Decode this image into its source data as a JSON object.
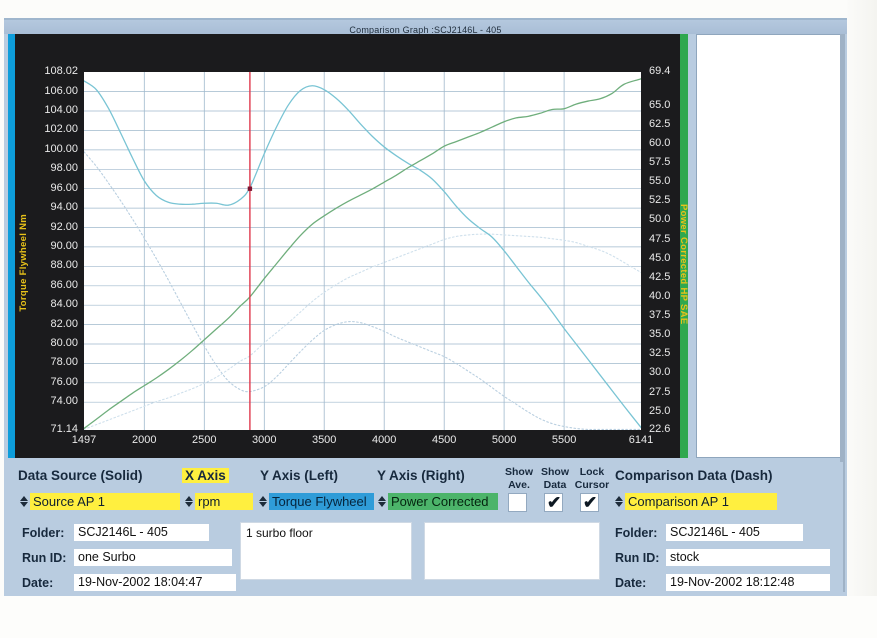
{
  "window": {
    "title": "Comparison Graph :SCJ2146L - 405"
  },
  "chart_data": {
    "type": "line",
    "title": "Comparison Graph :SCJ2146L - 405",
    "xlabel": "rpm",
    "ylabel_left": "Torque Flywheel Nm",
    "ylabel_right": "Power Corrected HP SAE",
    "xlim": [
      1497,
      6141
    ],
    "ylim_left": [
      71.14,
      108.02
    ],
    "ylim_right": [
      22.6,
      69.4
    ],
    "grid": true,
    "legend_position": "none",
    "x_ticks": [
      "1497",
      "2000",
      "2500",
      "3000",
      "3500",
      "4000",
      "4500",
      "5000",
      "5500",
      "6141"
    ],
    "y_ticks_left": [
      "108.02",
      "106.00",
      "104.00",
      "102.00",
      "100.00",
      "98.00",
      "96.00",
      "94.00",
      "92.00",
      "90.00",
      "88.00",
      "86.00",
      "84.00",
      "82.00",
      "80.00",
      "78.00",
      "76.00",
      "74.00",
      "71.14"
    ],
    "y_ticks_right": [
      "69.4",
      "65.0",
      "62.5",
      "60.0",
      "57.5",
      "55.0",
      "52.5",
      "50.0",
      "47.5",
      "45.0",
      "42.5",
      "40.0",
      "37.5",
      "35.0",
      "32.5",
      "30.0",
      "27.5",
      "25.0",
      "22.6"
    ],
    "cursor_rpm": 2880,
    "cursor_marker_torque": 96.0,
    "series": [
      {
        "name": "Torque Flywheel Nm (Source AP 1)",
        "style": "solid",
        "color": "#79c4d4",
        "axis": "left",
        "x": [
          1497,
          1600,
          1700,
          1800,
          1900,
          2000,
          2100,
          2200,
          2300,
          2400,
          2500,
          2600,
          2700,
          2800,
          2880,
          3000,
          3100,
          3200,
          3300,
          3400,
          3500,
          3600,
          3700,
          3800,
          3900,
          4000,
          4100,
          4200,
          4300,
          4400,
          4500,
          4600,
          4700,
          4800,
          4900,
          5000,
          5100,
          5200,
          5300,
          5400,
          5500,
          5600,
          5700,
          5800,
          5900,
          6000,
          6141
        ],
        "y": [
          107.1,
          106.2,
          104.3,
          101.8,
          99.2,
          96.8,
          95.3,
          94.6,
          94.4,
          94.4,
          94.5,
          94.5,
          94.3,
          94.9,
          96.1,
          99.6,
          102.3,
          104.6,
          106.1,
          106.6,
          106.2,
          105.3,
          104.1,
          102.7,
          101.4,
          100.3,
          99.4,
          98.6,
          97.9,
          97.0,
          95.7,
          94.2,
          92.9,
          91.9,
          91.0,
          89.6,
          88.0,
          86.4,
          84.9,
          83.3,
          81.6,
          80.0,
          78.4,
          76.8,
          75.2,
          73.6,
          71.4
        ]
      },
      {
        "name": "Power Corrected HP SAE (Source AP 1)",
        "style": "solid",
        "color": "#6fae7c",
        "axis": "right",
        "x": [
          1497,
          1600,
          1700,
          1800,
          1900,
          2000,
          2100,
          2200,
          2300,
          2400,
          2500,
          2600,
          2700,
          2800,
          2880,
          3000,
          3100,
          3200,
          3300,
          3400,
          3500,
          3600,
          3700,
          3800,
          3900,
          4000,
          4100,
          4200,
          4300,
          4400,
          4500,
          4600,
          4700,
          4800,
          4900,
          5000,
          5100,
          5200,
          5300,
          5400,
          5500,
          5600,
          5700,
          5800,
          5900,
          6000,
          6141
        ],
        "y": [
          22.8,
          24.0,
          25.2,
          26.3,
          27.4,
          28.4,
          29.4,
          30.5,
          31.7,
          33.0,
          34.4,
          35.8,
          37.2,
          38.8,
          40.0,
          42.4,
          44.3,
          46.2,
          48.0,
          49.5,
          50.6,
          51.6,
          52.5,
          53.3,
          54.1,
          55.0,
          55.9,
          56.9,
          57.8,
          58.7,
          59.7,
          60.3,
          60.9,
          61.5,
          62.2,
          62.9,
          63.4,
          63.6,
          64.0,
          64.5,
          64.6,
          65.2,
          65.6,
          65.9,
          66.6,
          67.8,
          68.5
        ]
      },
      {
        "name": "Torque Flywheel Nm (Comparison AP 1 - stock)",
        "style": "dash",
        "color": "#b9cfe0",
        "axis": "left",
        "x": [
          1497,
          1600,
          1700,
          1800,
          1900,
          2000,
          2100,
          2200,
          2300,
          2400,
          2500,
          2600,
          2700,
          2800,
          2880,
          3000,
          3100,
          3200,
          3300,
          3400,
          3500,
          3600,
          3700,
          3800,
          3900,
          4000,
          4100,
          4200,
          4300,
          4400,
          4500,
          4600,
          4700,
          4800,
          4900,
          5000,
          5100,
          5200,
          5300,
          5400,
          5500,
          5600,
          5700,
          5800,
          5900,
          6000,
          6141
        ],
        "y": [
          99.8,
          98.3,
          96.6,
          94.8,
          92.9,
          90.9,
          88.8,
          86.6,
          84.3,
          82.0,
          79.8,
          77.8,
          76.2,
          75.3,
          75.1,
          75.6,
          76.6,
          77.9,
          79.2,
          80.4,
          81.4,
          82.0,
          82.3,
          82.2,
          81.8,
          81.3,
          80.7,
          80.2,
          79.7,
          79.2,
          78.7,
          78.0,
          77.2,
          76.4,
          75.5,
          74.6,
          73.8,
          73.0,
          72.3,
          71.8,
          71.5,
          71.3,
          71.2,
          71.2,
          71.2,
          71.2,
          71.2
        ]
      },
      {
        "name": "Power Corrected HP SAE (Comparison AP 1 - stock)",
        "style": "dash",
        "color": "#cfe0ec",
        "axis": "right",
        "x": [
          1497,
          1600,
          1700,
          1800,
          1900,
          2000,
          2100,
          2200,
          2300,
          2400,
          2500,
          2600,
          2700,
          2800,
          2880,
          3000,
          3100,
          3200,
          3300,
          3400,
          3500,
          3600,
          3700,
          3800,
          3900,
          4000,
          4100,
          4200,
          4300,
          4400,
          4500,
          4600,
          4700,
          4800,
          4900,
          5000,
          5100,
          5200,
          5300,
          5400,
          5500,
          5600,
          5700,
          5800,
          5900,
          6000,
          6141
        ],
        "y": [
          22.7,
          23.3,
          23.9,
          24.5,
          25.1,
          25.7,
          26.3,
          26.8,
          27.4,
          28.0,
          28.7,
          29.5,
          30.5,
          31.6,
          32.3,
          34.0,
          35.3,
          36.6,
          38.0,
          39.4,
          40.6,
          41.6,
          42.5,
          43.2,
          43.9,
          44.5,
          45.1,
          45.7,
          46.3,
          46.9,
          47.5,
          47.9,
          48.1,
          48.2,
          48.2,
          48.1,
          48.0,
          47.9,
          47.8,
          47.6,
          47.4,
          47.1,
          46.6,
          46.1,
          45.4,
          44.5,
          43.2
        ]
      }
    ]
  },
  "controls": {
    "data_source": {
      "heading": "Data Source (Solid)",
      "value": "Source AP 1"
    },
    "x_axis": {
      "heading": "X Axis",
      "value": "rpm"
    },
    "y_axis_left": {
      "heading": "Y Axis (Left)",
      "value": "Torque Flywheel"
    },
    "y_axis_right": {
      "heading": "Y Axis (Right)",
      "value": "Power Corrected"
    },
    "show_ave": {
      "heading_line1": "Show",
      "heading_line2": "Ave.",
      "checked_mark": ""
    },
    "show_data": {
      "heading_line1": "Show",
      "heading_line2": "Data",
      "checked_mark": "✔"
    },
    "lock_cursor": {
      "heading_line1": "Lock",
      "heading_line2": "Cursor",
      "checked_mark": "✔"
    },
    "comparison_data": {
      "heading": "Comparison Data (Dash)",
      "value": "Comparison AP 1"
    }
  },
  "source_info": {
    "folder_label": "Folder:",
    "folder_value": "SCJ2146L - 405",
    "run_id_label": "Run ID:",
    "run_id_value": "one Surbo",
    "date_label": "Date:",
    "date_value": "19-Nov-2002  18:04:47",
    "note": "1 surbo floor"
  },
  "comparison_info": {
    "folder_label": "Folder:",
    "folder_value": "SCJ2146L - 405",
    "run_id_label": "Run ID:",
    "run_id_value": "stock",
    "date_label": "Date:",
    "date_value": "19-Nov-2002  18:12:48",
    "note": ""
  },
  "colors": {
    "panel": "#b9cce0",
    "graph_background": "#1b1b1d",
    "left_accent": "#0d9ddb",
    "right_accent": "#2fa84f",
    "yellow_field": "#ffef3f",
    "blue_field": "#2f9cd8",
    "green_field": "#4cb46a",
    "cursor_line": "#e03a4e",
    "axis_title": "#e8c219"
  }
}
